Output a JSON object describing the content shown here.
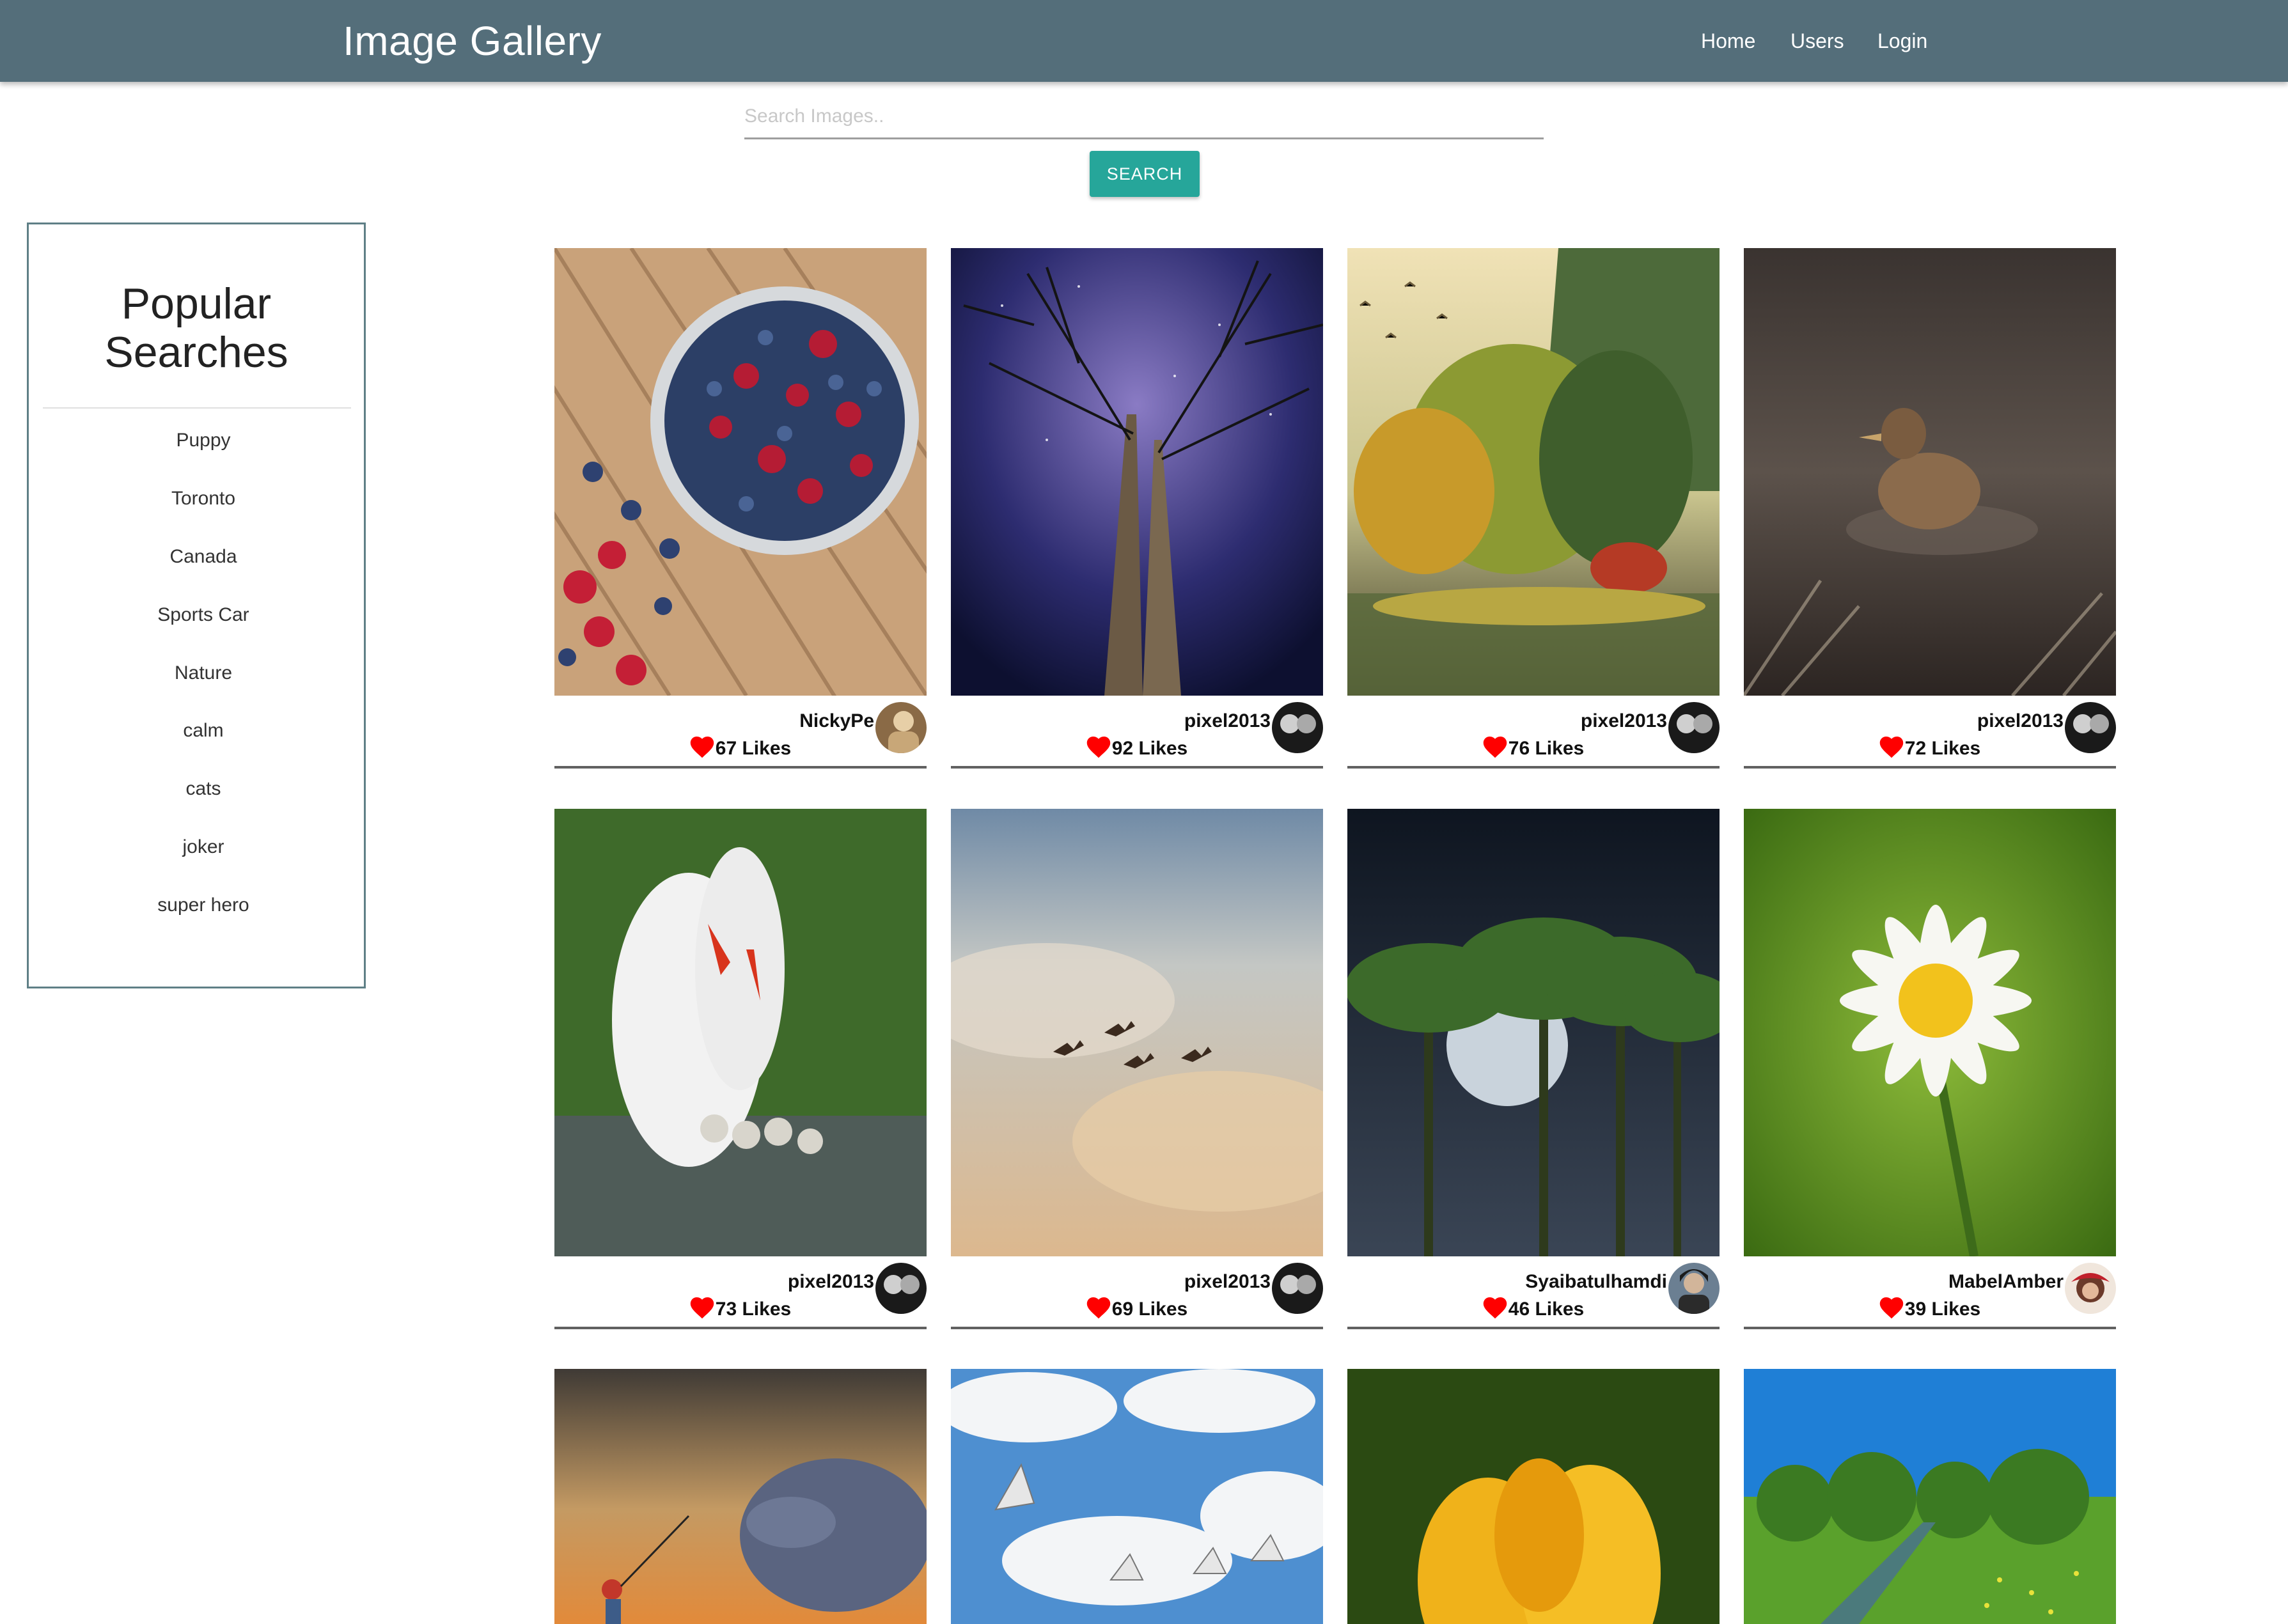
{
  "header": {
    "title": "Image Gallery",
    "nav": [
      {
        "label": "Home"
      },
      {
        "label": "Users"
      },
      {
        "label": "Login"
      }
    ]
  },
  "search": {
    "placeholder": "Search Images..",
    "button_label": "SEARCH"
  },
  "sidebar": {
    "title": "Popular Searches",
    "items": [
      {
        "label": "Puppy"
      },
      {
        "label": "Toronto"
      },
      {
        "label": "Canada"
      },
      {
        "label": "Sports Car"
      },
      {
        "label": "Nature"
      },
      {
        "label": "calm"
      },
      {
        "label": "cats"
      },
      {
        "label": "joker"
      },
      {
        "label": "super hero"
      }
    ]
  },
  "colors": {
    "navbar": "#546e7a",
    "accent_button": "#26a69a",
    "heart": "#ff0000",
    "sidebar_border": "#5f7f86"
  },
  "gallery": {
    "cards": [
      {
        "photo": "berries-bowl-photo",
        "username": "NickyPe",
        "likes_text": "67 Likes"
      },
      {
        "photo": "night-sky-trees-photo",
        "username": "pixel2013",
        "likes_text": "92 Likes"
      },
      {
        "photo": "autumn-lake-photo",
        "username": "pixel2013",
        "likes_text": "76 Likes"
      },
      {
        "photo": "duck-photo",
        "username": "pixel2013",
        "likes_text": "72 Likes"
      },
      {
        "photo": "swans-photo",
        "username": "pixel2013",
        "likes_text": "73 Likes"
      },
      {
        "photo": "birds-clouds-photo",
        "username": "pixel2013",
        "likes_text": "69 Likes"
      },
      {
        "photo": "palms-moon-photo",
        "username": "Syaibatulhamdi",
        "likes_text": "46 Likes"
      },
      {
        "photo": "daisy-photo",
        "username": "MabelAmber",
        "likes_text": "39 Likes"
      },
      {
        "photo": "dolphin-fishing-photo",
        "username": "",
        "likes_text": ""
      },
      {
        "photo": "seagulls-sky-photo",
        "username": "",
        "likes_text": ""
      },
      {
        "photo": "yellow-tulip-photo",
        "username": "",
        "likes_text": ""
      },
      {
        "photo": "green-meadow-photo",
        "username": "",
        "likes_text": ""
      }
    ]
  }
}
